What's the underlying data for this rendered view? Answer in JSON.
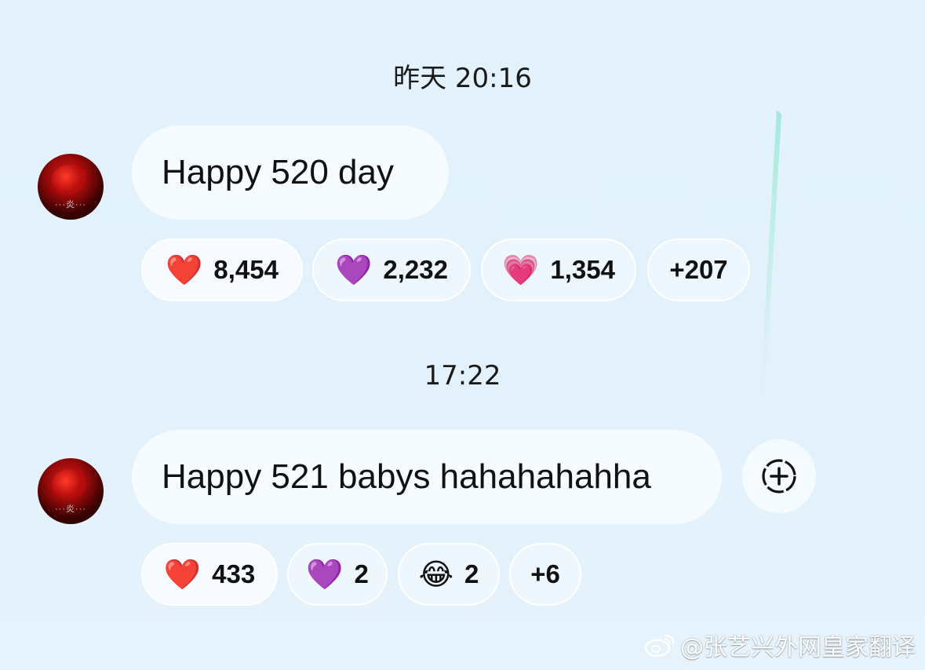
{
  "messages": [
    {
      "timestamp": "昨天 20:16",
      "text": "Happy 520 day",
      "reactions": [
        {
          "emoji": "❤️",
          "icon": "red-heart-icon",
          "count": "8,454"
        },
        {
          "emoji": "💜",
          "icon": "purple-heart-icon",
          "count": "2,232"
        },
        {
          "emoji": "💗",
          "icon": "growing-heart-icon",
          "count": "1,354"
        },
        {
          "emoji": "",
          "icon": "",
          "count": "+207"
        }
      ]
    },
    {
      "timestamp": "17:22",
      "text": "Happy 521 babys hahahahahha",
      "reactions": [
        {
          "emoji": "❤️",
          "icon": "red-heart-icon",
          "count": "433"
        },
        {
          "emoji": "💜",
          "icon": "purple-heart-icon",
          "count": "2"
        },
        {
          "emoji": "😂",
          "icon": "tears-of-joy-icon",
          "count": "2"
        },
        {
          "emoji": "",
          "icon": "",
          "count": "+6"
        }
      ]
    }
  ],
  "add_reaction_icon": "add-reaction-icon",
  "avatar_mark": "···炎···",
  "watermark": "@张艺兴外网皇家翻译",
  "colors": {
    "background": "#e3f2fc",
    "bubble": "#f6fbff",
    "reaction_pill": "#eef7fe"
  }
}
